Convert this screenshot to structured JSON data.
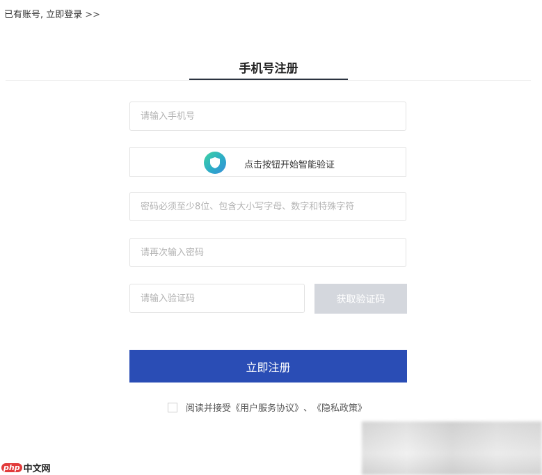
{
  "header": {
    "has_account": "已有账号, ",
    "login_link": "立即登录",
    "arrows": ">>"
  },
  "tab": {
    "title": "手机号注册"
  },
  "form": {
    "phone_placeholder": "请输入手机号",
    "verify_label": "点击按钮开始智能验证",
    "password_placeholder": "密码必须至少8位、包含大小写字母、数字和特殊字符",
    "confirm_placeholder": "请再次输入密码",
    "code_placeholder": "请输入验证码",
    "get_code_label": "获取验证码",
    "submit_label": "立即注册"
  },
  "agreement": {
    "prefix": "阅读并接受",
    "terms": "《用户服务协议》",
    "separator": "、",
    "privacy": "《隐私政策》"
  },
  "watermark": {
    "badge": "php",
    "text": "中文网"
  },
  "colors": {
    "primary": "#2a4db5",
    "disabled_button": "#d4d7dd",
    "tab_underline": "#2b3340"
  }
}
